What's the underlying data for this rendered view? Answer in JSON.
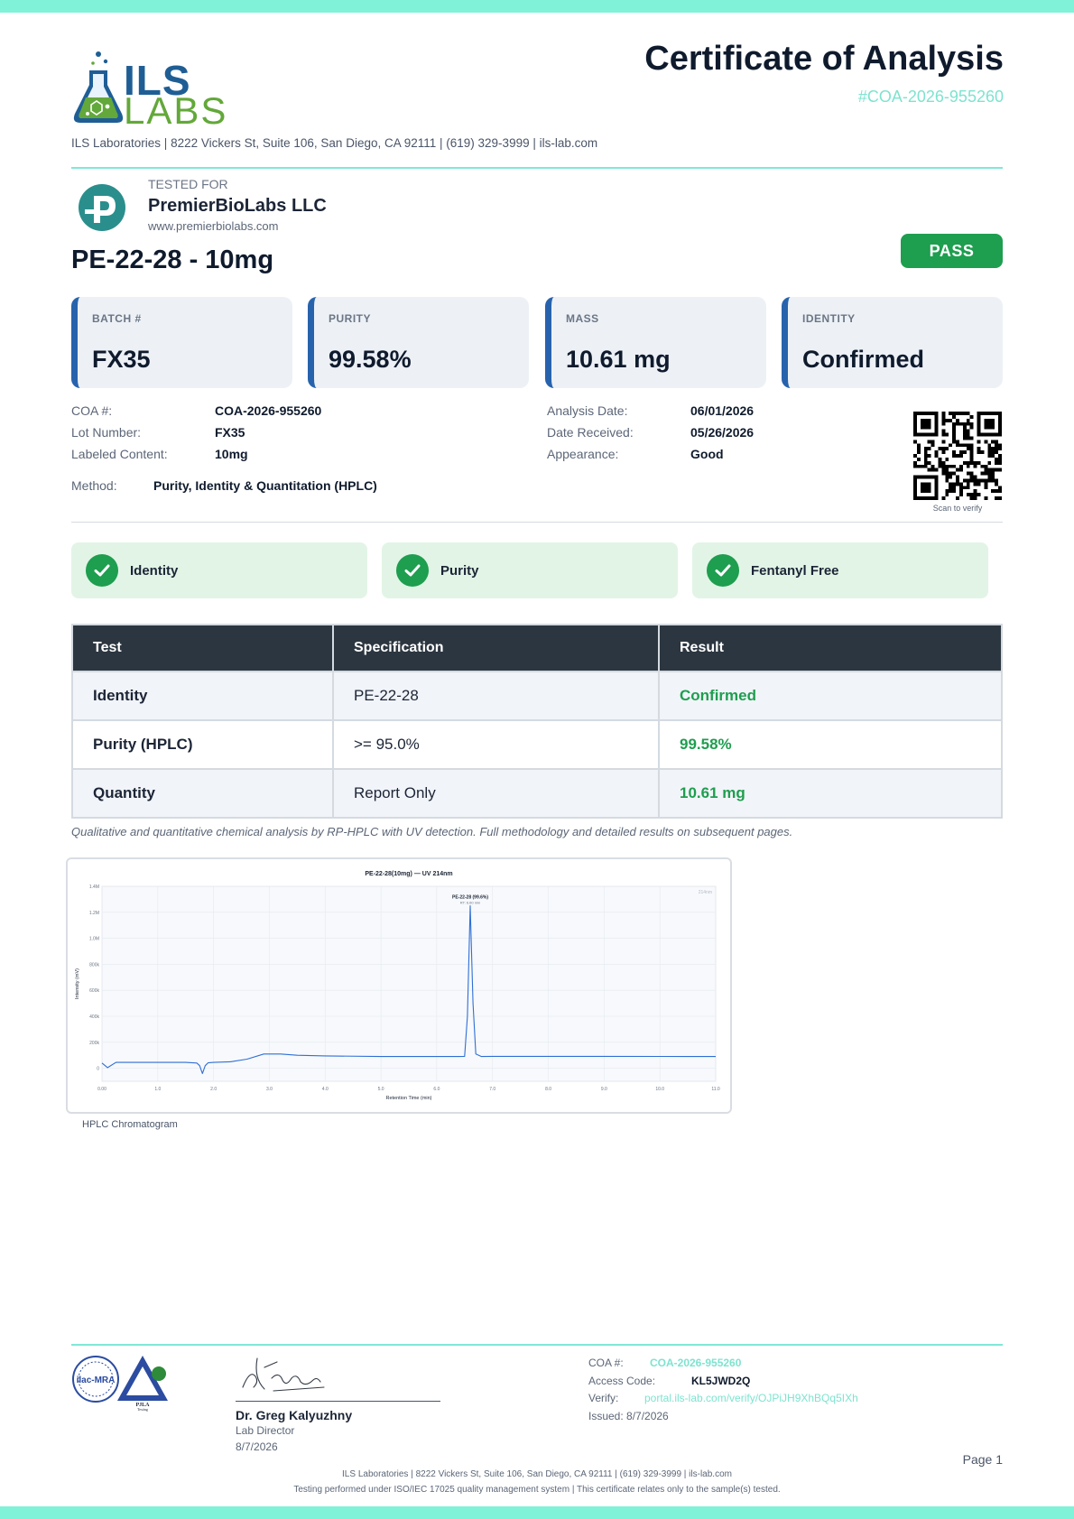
{
  "header": {
    "logo_top": "ILS",
    "logo_bottom": "LABS",
    "title": "Certificate of Analysis",
    "coa_number": "#COA-2026-955260",
    "lab_line": "ILS Laboratories  |  8222 Vickers St, Suite 106, San Diego, CA 92111  |  (619) 329-3999  |  ils-lab.com"
  },
  "client": {
    "tested_for_label": "TESTED FOR",
    "name": "PremierBioLabs LLC",
    "website": "www.premierbiolabs.com"
  },
  "product": {
    "name": "PE-22-28 - 10mg",
    "status": "PASS"
  },
  "stats": [
    {
      "label": "BATCH #",
      "value": "FX35"
    },
    {
      "label": "PURITY",
      "value": "99.58%"
    },
    {
      "label": "MASS",
      "value": "10.61 mg"
    },
    {
      "label": "IDENTITY",
      "value": "Confirmed"
    }
  ],
  "meta_left": [
    {
      "key": "COA #:",
      "value": "COA-2026-955260"
    },
    {
      "key": "Lot Number:",
      "value": "FX35"
    },
    {
      "key": "Labeled Content:",
      "value": "10mg"
    }
  ],
  "meta_right": [
    {
      "key": "Analysis Date:",
      "value": "06/01/2026"
    },
    {
      "key": "Date Received:",
      "value": "05/26/2026"
    },
    {
      "key": "Appearance:",
      "value": "Good"
    }
  ],
  "method": {
    "key": "Method:",
    "value": "Purity, Identity & Quantitation (HPLC)"
  },
  "qr_caption": "Scan to verify",
  "checks": [
    "Identity",
    "Purity",
    "Fentanyl Free"
  ],
  "results": {
    "headers": [
      "Test",
      "Specification",
      "Result"
    ],
    "rows": [
      {
        "test": "Identity",
        "spec": "PE-22-28",
        "result": "Confirmed"
      },
      {
        "test": "Purity (HPLC)",
        "spec": ">= 95.0%",
        "result": "99.58%"
      },
      {
        "test": "Quantity",
        "spec": "Report Only",
        "result": "10.61 mg"
      }
    ]
  },
  "note": "Qualitative and quantitative chemical analysis by RP-HPLC with UV detection. Full methodology and detailed results on subsequent pages.",
  "chart_data": {
    "type": "line",
    "title": "PE-22-28(10mg) — UV 214nm",
    "xlabel": "Retention Time (min)",
    "ylabel": "Intensity (mV)",
    "xlim": [
      0,
      11.0
    ],
    "ylim": [
      -100000,
      1400000
    ],
    "x_ticks": [
      "0.00",
      "1.0",
      "2.0",
      "3.0",
      "4.0",
      "5.0",
      "6.0",
      "7.0",
      "8.0",
      "9.0",
      "10.0",
      "11.0"
    ],
    "y_ticks": [
      {
        "v": 0,
        "label": "0"
      },
      {
        "v": 200000,
        "label": "200k"
      },
      {
        "v": 400000,
        "label": "400k"
      },
      {
        "v": 600000,
        "label": "600k"
      },
      {
        "v": 800000,
        "label": "800k"
      },
      {
        "v": 1000000,
        "label": "1.0M"
      },
      {
        "v": 1200000,
        "label": "1.2M"
      },
      {
        "v": 1400000,
        "label": "1.4M"
      }
    ],
    "peak_label": "PE-22-28 (99.6%)",
    "peak_sublabel": "RT: 6.60 min",
    "corner_label": "214nm",
    "grid": true,
    "series": [
      {
        "color": "#2f6fd6",
        "x": [
          0.0,
          0.1,
          0.25,
          0.5,
          1.0,
          1.5,
          1.7,
          1.75,
          1.8,
          1.85,
          1.9,
          2.0,
          2.3,
          2.6,
          2.9,
          3.2,
          3.5,
          4.0,
          5.0,
          6.0,
          6.4,
          6.5,
          6.55,
          6.6,
          6.65,
          6.7,
          6.8,
          7.0,
          8.0,
          9.0,
          10.0,
          11.0
        ],
        "y": [
          40000,
          5000,
          45000,
          45000,
          45000,
          45000,
          40000,
          20000,
          -40000,
          20000,
          42000,
          45000,
          50000,
          70000,
          110000,
          110000,
          100000,
          95000,
          90000,
          90000,
          90000,
          92000,
          400000,
          1250000,
          500000,
          110000,
          90000,
          92000,
          92000,
          92000,
          91000,
          90000
        ]
      }
    ]
  },
  "chart_caption": "HPLC Chromatogram",
  "seals": {
    "left": "ilac-MRA",
    "right": "PJLA",
    "right_sub": "Testing"
  },
  "signature": {
    "name": "Dr. Greg Kalyuzhny",
    "role": "Lab Director",
    "date": "8/7/2026"
  },
  "verify": {
    "coa_key": "COA #:",
    "coa_value": "COA-2026-955260",
    "access_key": "Access Code:",
    "access_value": "KL5JWD2Q",
    "verify_key": "Verify:",
    "verify_value": "portal.ils-lab.com/verify/OJPiJH9XhBQq5IXh",
    "issued": "Issued: 8/7/2026"
  },
  "footer": {
    "page": "Page 1",
    "line1": "ILS Laboratories  |  8222 Vickers St, Suite 106, San Diego, CA 92111  |  (619) 329-3999  |  ils-lab.com",
    "line2": "Testing performed under ISO/IEC 17025 quality management system  |  This certificate relates only to the sample(s) tested."
  }
}
